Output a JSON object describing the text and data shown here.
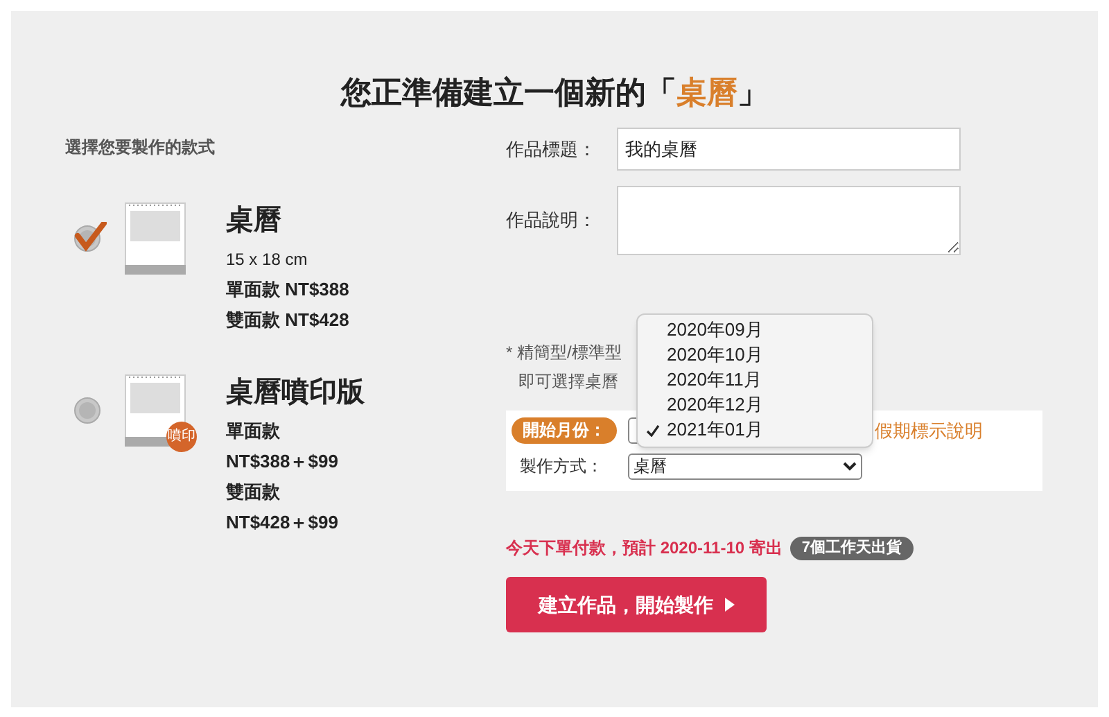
{
  "title": {
    "prefix": "您正準備建立一個新的「",
    "highlight": "桌曆",
    "suffix": "」"
  },
  "styles_heading": "選擇您要製作的款式",
  "styles": [
    {
      "name": "桌曆",
      "selected": true,
      "lines": [
        {
          "text": "15 x 18 cm",
          "bold": false
        },
        {
          "text": "單面款 NT$388",
          "bold": true
        },
        {
          "text": "雙面款 NT$428",
          "bold": true
        }
      ]
    },
    {
      "name": "桌曆噴印版",
      "selected": false,
      "badge": "噴印",
      "lines": [
        {
          "text": "單面款",
          "bold": true
        },
        {
          "text": "NT$388＋$99",
          "bold": true
        },
        {
          "text": "雙面款",
          "bold": true
        },
        {
          "text": "NT$428＋$99",
          "bold": true
        }
      ]
    }
  ],
  "form": {
    "title_label": "作品標題：",
    "title_value": "我的桌曆",
    "desc_label": "作品說明：",
    "note_lines": [
      "* 精簡型/標準型",
      "即可選擇桌曆"
    ],
    "start_month_label": "開始月份：",
    "holiday_link": "假期標示說明",
    "method_label": "製作方式：",
    "method_value": "桌曆"
  },
  "month_menu": [
    {
      "label": "2020年09月",
      "selected": false
    },
    {
      "label": "2020年10月",
      "selected": false
    },
    {
      "label": "2020年11月",
      "selected": false
    },
    {
      "label": "2020年12月",
      "selected": false
    },
    {
      "label": "2021年01月",
      "selected": true
    }
  ],
  "shipping": {
    "text": "今天下單付款，預計 2020-11-10 寄出",
    "badge": "7個工作天出貨"
  },
  "submit_button": "建立作品，開始製作"
}
